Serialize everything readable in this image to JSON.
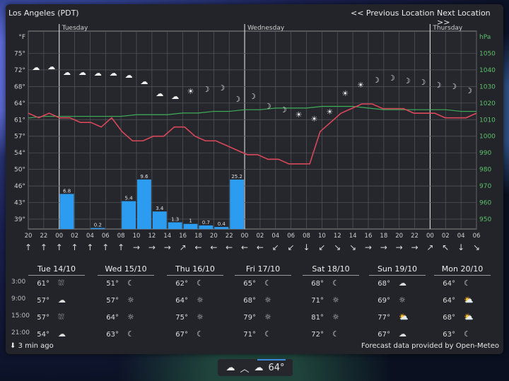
{
  "header": {
    "location": "Los Angeles (PDT)",
    "prev": "<< Previous Location",
    "next": "Next Location >>"
  },
  "chart_data": {
    "type": "line",
    "day_labels": [
      "Tuesday",
      "Wednesday",
      "Thursday"
    ],
    "y_left_ticks": [
      "°F",
      "75°",
      "72°",
      "68°",
      "64°",
      "61°",
      "57°",
      "54°",
      "50°",
      "46°",
      "43°",
      "39°"
    ],
    "y_right_ticks": [
      "hPa",
      "1050",
      "1040",
      "1030",
      "1020",
      "1010",
      "1000",
      "990",
      "980",
      "970",
      "960",
      "950"
    ],
    "x_ticks": [
      "20",
      "22",
      "00",
      "02",
      "04",
      "06",
      "08",
      "10",
      "12",
      "14",
      "16",
      "18",
      "20",
      "22",
      "00",
      "02",
      "04",
      "06",
      "08",
      "10",
      "12",
      "14",
      "16",
      "18",
      "20",
      "22",
      "00",
      "02",
      "04",
      "06"
    ],
    "temperature_F": [
      62,
      61,
      62,
      61,
      61,
      60,
      60,
      59,
      61,
      58,
      56,
      56,
      57,
      57,
      59,
      59,
      57,
      56,
      56,
      55,
      54,
      53,
      53,
      52,
      52,
      51,
      51,
      51,
      58,
      60,
      62,
      63,
      64,
      64,
      63,
      63,
      63,
      62,
      62,
      62,
      61,
      61,
      61,
      62
    ],
    "pressure_hPa": [
      1011,
      1012,
      1012,
      1012,
      1012,
      1012,
      1012,
      1013,
      1013,
      1013,
      1014,
      1014,
      1015,
      1015,
      1016,
      1016,
      1017,
      1017,
      1017,
      1018,
      1018,
      1018,
      1017,
      1016,
      1016,
      1016,
      1016,
      1016,
      1015,
      1015
    ],
    "precip_bars": [
      {
        "x": 0,
        "v": 0,
        "label": ""
      },
      {
        "x": 2,
        "v": 6.8,
        "label": "6.8"
      },
      {
        "x": 4,
        "v": 0.2,
        "label": "0.2"
      },
      {
        "x": 6,
        "v": 5.4,
        "label": "5.4"
      },
      {
        "x": 7,
        "v": 9.6,
        "label": "9.6"
      },
      {
        "x": 8,
        "v": 3.4,
        "label": "3.4"
      },
      {
        "x": 9,
        "v": 1.3,
        "label": "1.3"
      },
      {
        "x": 10,
        "v": 1,
        "label": "1"
      },
      {
        "x": 11,
        "v": 0.7,
        "label": "0.7"
      },
      {
        "x": 12,
        "v": 0.4,
        "label": "0.4"
      },
      {
        "x": 13,
        "v": 25.2,
        "label": "25.2"
      }
    ],
    "wind_arrows": [
      "↑",
      "↑",
      "↑",
      "↑",
      "↑",
      "↑",
      "↑",
      "→",
      "→",
      "→",
      "↗",
      "←",
      "←",
      "←",
      "←",
      "←",
      "↙",
      "↙",
      "↓",
      "↙",
      "↘",
      "↘",
      "→",
      "→",
      "→",
      "→",
      "↗",
      "↖",
      "↓",
      "↘"
    ],
    "weather_icons": [
      "☁",
      "☁",
      "☁",
      "☁",
      "☁",
      "☁",
      "☁",
      "☁",
      "☁",
      "☁",
      "☀",
      "☽",
      "☽",
      "☽",
      "☽",
      "☽",
      "☽",
      "☀",
      "☀",
      "☀",
      "☀",
      "☀",
      "☽",
      "☽",
      "☽",
      "☽",
      "☽",
      "☽",
      "☽"
    ]
  },
  "days": [
    {
      "head": "Tue 14/10",
      "rows": [
        [
          "61°",
          "cloud-rain"
        ],
        [
          "57°",
          "cloud"
        ],
        [
          "57°",
          "cloud-rain"
        ],
        [
          "54°",
          "cloud"
        ]
      ]
    },
    {
      "head": "Wed 15/10",
      "rows": [
        [
          "51°",
          "moon"
        ],
        [
          "57°",
          "sun"
        ],
        [
          "64°",
          "sun"
        ],
        [
          "63°",
          "moon"
        ]
      ]
    },
    {
      "head": "Thu 16/10",
      "rows": [
        [
          "62°",
          "moon"
        ],
        [
          "64°",
          "sun"
        ],
        [
          "75°",
          "sun"
        ],
        [
          "67°",
          "moon"
        ]
      ]
    },
    {
      "head": "Fri 17/10",
      "rows": [
        [
          "65°",
          "moon"
        ],
        [
          "68°",
          "sun"
        ],
        [
          "79°",
          "sun"
        ],
        [
          "71°",
          "moon"
        ]
      ]
    },
    {
      "head": "Sat 18/10",
      "rows": [
        [
          "68°",
          "moon"
        ],
        [
          "71°",
          "sun"
        ],
        [
          "81°",
          "sun"
        ],
        [
          "72°",
          "moon"
        ]
      ]
    },
    {
      "head": "Sun 19/10",
      "rows": [
        [
          "68°",
          "moon-cloud"
        ],
        [
          "69°",
          "sun"
        ],
        [
          "77°",
          "sun-cloud"
        ],
        [
          "67°",
          "cloud"
        ]
      ]
    },
    {
      "head": "Mon 20/10",
      "rows": [
        [
          "64°",
          "moon"
        ],
        [
          "64°",
          "sun-cloud"
        ],
        [
          "68°",
          "sun-cloud"
        ],
        [
          "63°",
          "moon"
        ]
      ]
    }
  ],
  "times": [
    "3:00",
    "9:00",
    "15:00",
    "21:00"
  ],
  "footer": {
    "updated": "3 min ago",
    "credit": "Forecast data provided by Open-Meteo"
  },
  "taskbar": {
    "temp": "64°"
  },
  "colors": {
    "temp_line": "#d9475a",
    "pressure_line": "#3fae5a",
    "precip_bar": "#2b9cf0",
    "grid": "#55575c"
  }
}
